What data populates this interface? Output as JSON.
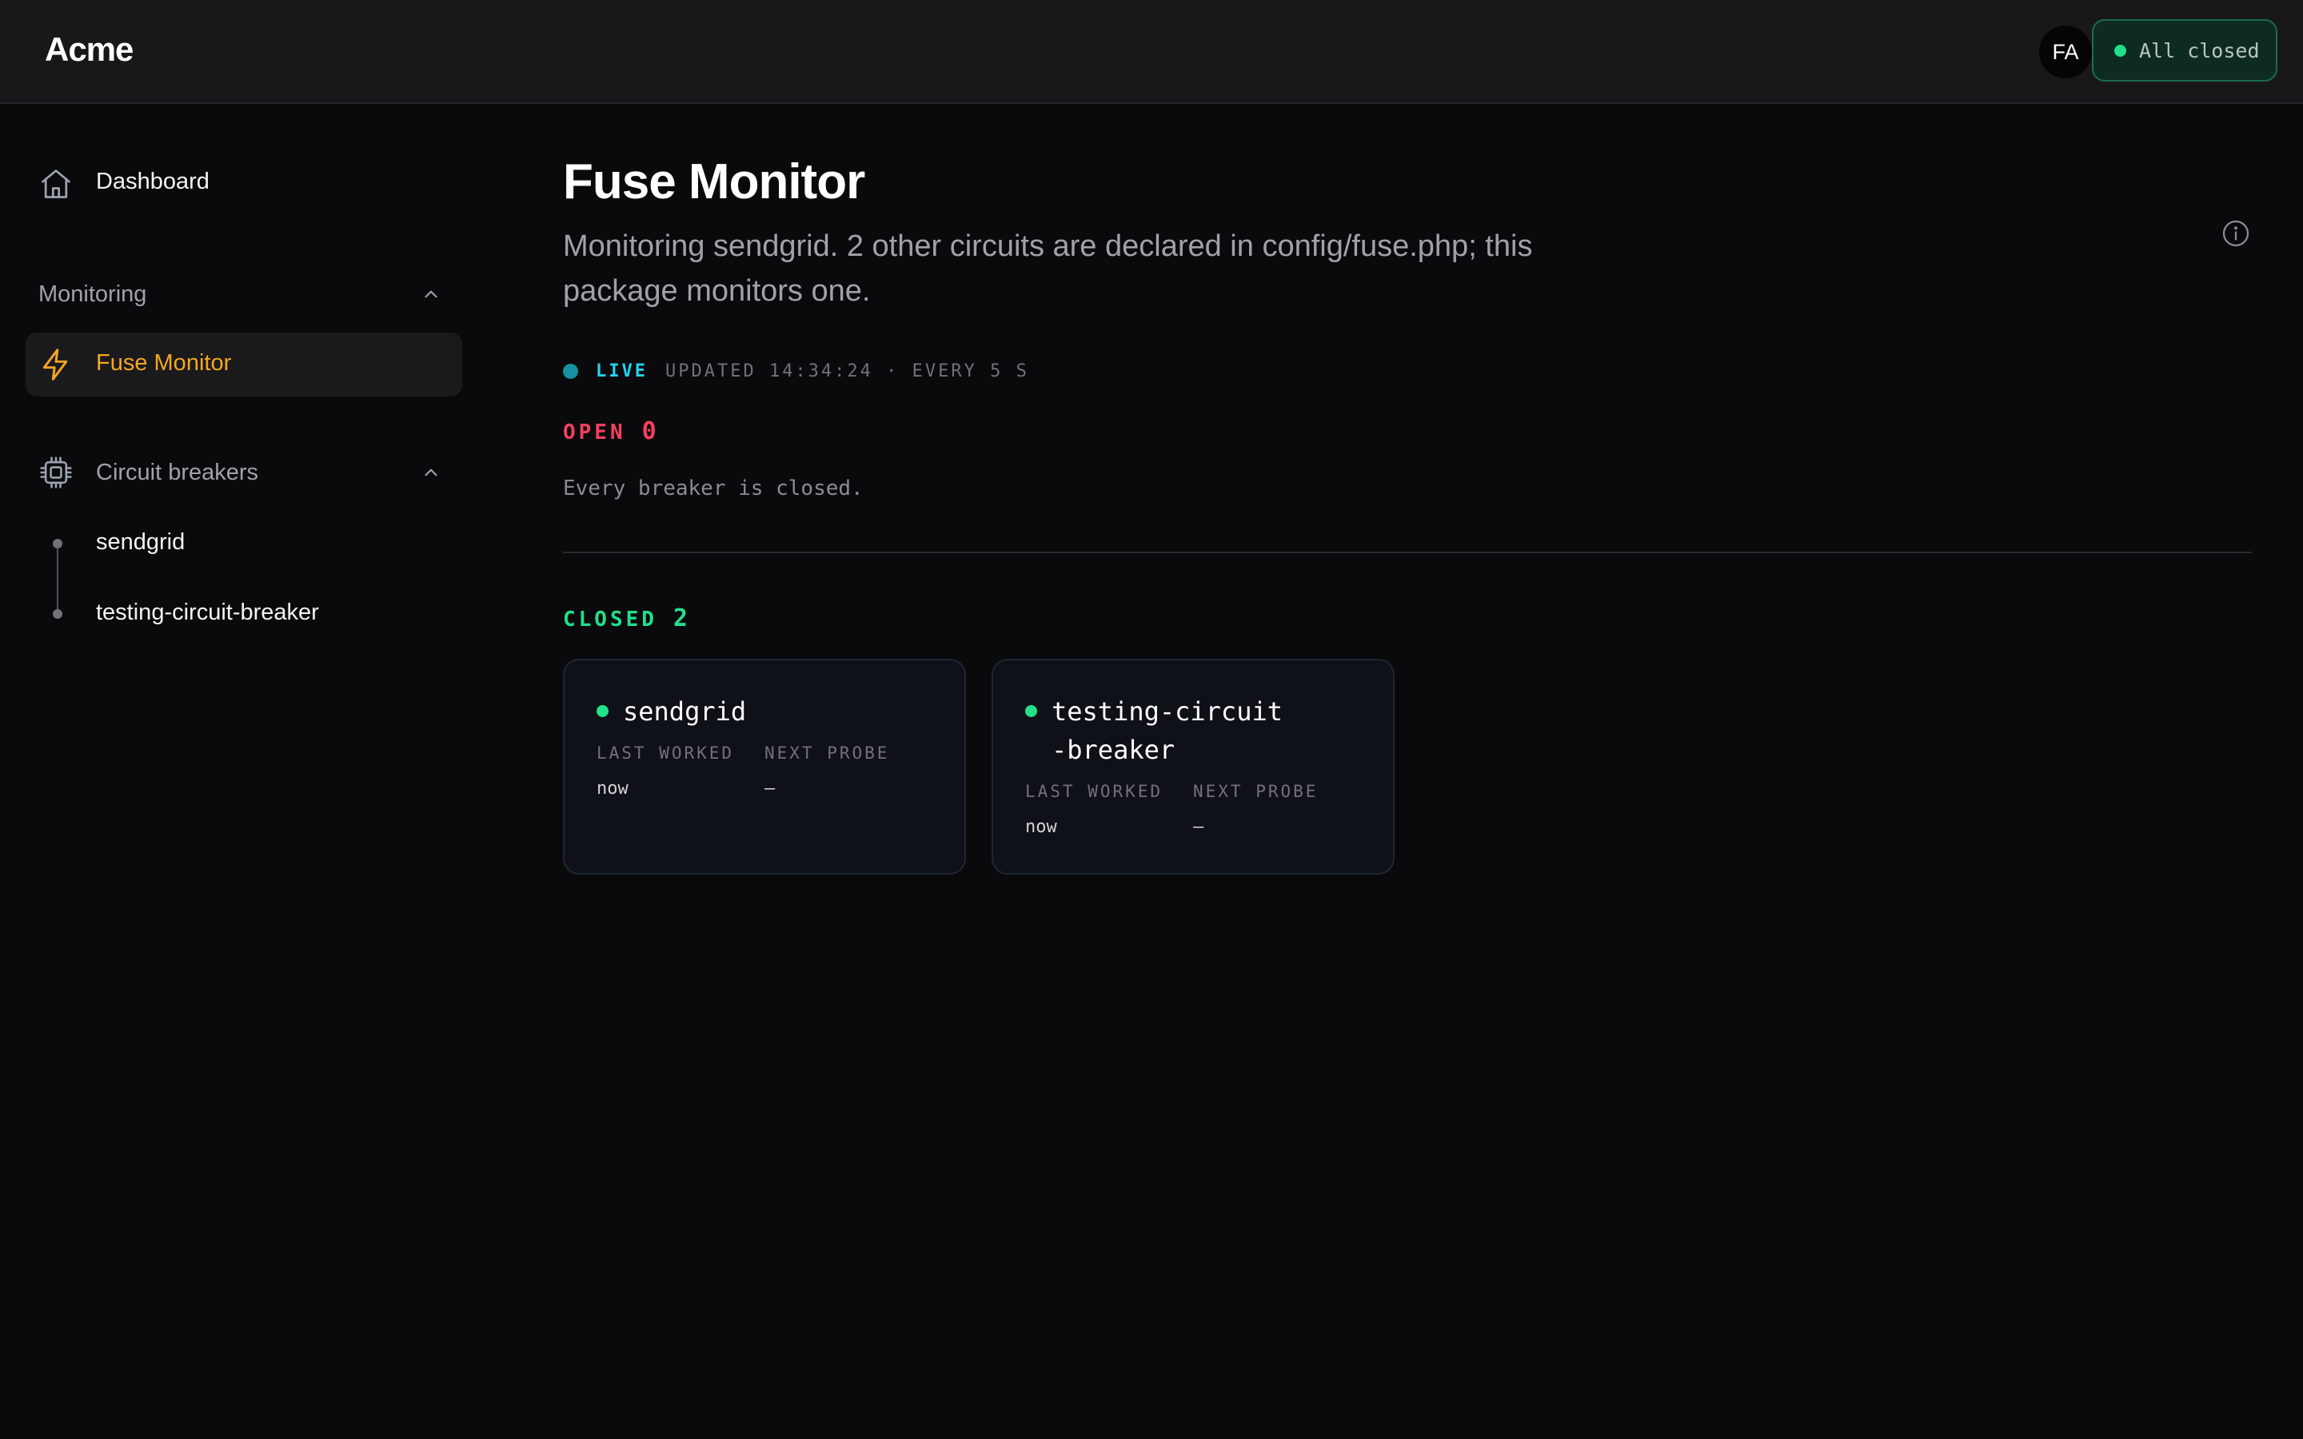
{
  "header": {
    "brand": "Acme",
    "avatar_initials": "FA",
    "status_label": "All closed",
    "status_color": "#22e08a"
  },
  "sidebar": {
    "dashboard": {
      "label": "Dashboard",
      "icon": "home-icon"
    },
    "monitoring": {
      "heading": "Monitoring",
      "items": [
        {
          "label": "Fuse Monitor",
          "icon": "bolt-icon",
          "active": true,
          "color": "#f5a524"
        }
      ]
    },
    "circuit_breakers": {
      "heading": "Circuit breakers",
      "icon": "chip-icon",
      "items": [
        {
          "label": "sendgrid"
        },
        {
          "label": "testing-circuit-breaker"
        }
      ]
    }
  },
  "main": {
    "title": "Fuse Monitor",
    "subtitle": "Monitoring sendgrid. 2 other circuits are declared in config/fuse.php; this package monitors one.",
    "live": {
      "label": "LIVE",
      "status": "UPDATED 14:34:24 · EVERY 5 S"
    },
    "open": {
      "label": "OPEN",
      "count": "0",
      "empty_message": "Every breaker is closed."
    },
    "closed": {
      "label": "CLOSED",
      "count": "2",
      "cards": [
        {
          "name": "sendgrid",
          "last_worked_label": "LAST WORKED",
          "last_worked": "now",
          "next_probe_label": "NEXT PROBE",
          "next_probe": "—"
        },
        {
          "name": "testing-circuit-breaker",
          "last_worked_label": "LAST WORKED",
          "last_worked": "now",
          "next_probe_label": "NEXT PROBE",
          "next_probe": "—"
        }
      ]
    }
  }
}
